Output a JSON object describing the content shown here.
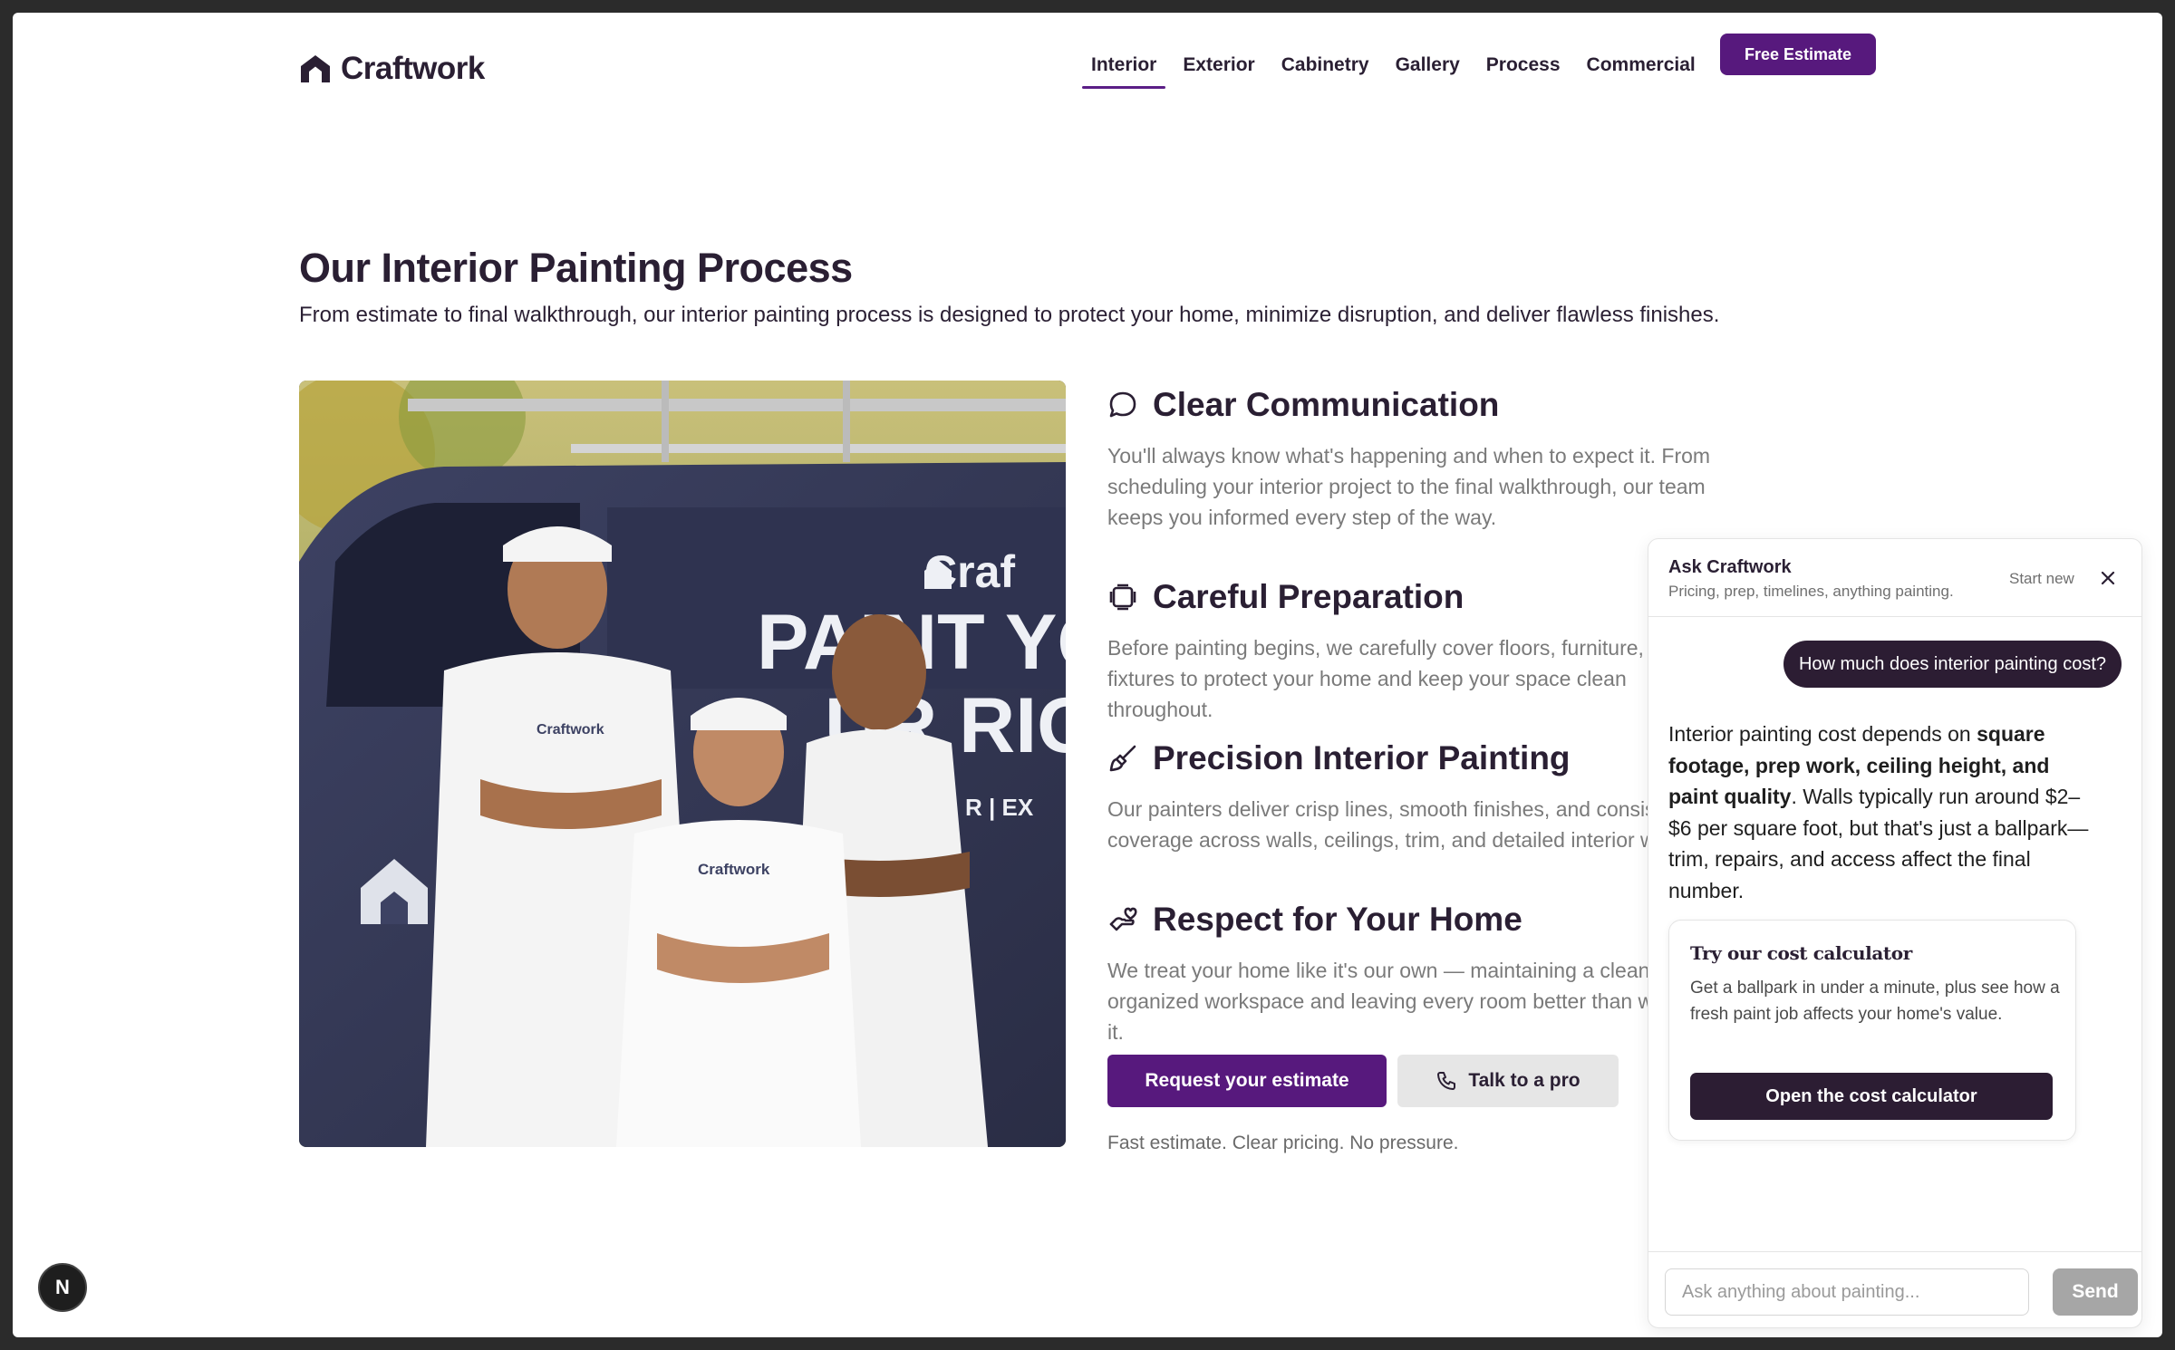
{
  "brand": {
    "name": "Craftwork",
    "accent": "#57197d",
    "dark": "#2c1d33"
  },
  "nav": {
    "items": [
      {
        "label": "Interior",
        "active": true
      },
      {
        "label": "Exterior"
      },
      {
        "label": "Cabinetry"
      },
      {
        "label": "Gallery"
      },
      {
        "label": "Process"
      },
      {
        "label": "Commercial"
      }
    ],
    "cta": "Free Estimate"
  },
  "hero": {
    "title": "Our Interior Painting Process",
    "subtitle": "From estimate to final walkthrough, our interior painting process is designed to protect your home, minimize disruption, and deliver flawless finishes."
  },
  "photo": {
    "van_text": [
      "Craf",
      "PAINT YO",
      "UR RIG",
      "R | EX"
    ],
    "shirt_text": "Craftwork"
  },
  "features": [
    {
      "icon": "chat-bubble-icon",
      "title": "Clear Communication",
      "body": "You'll always know what's happening and when to expect it. From scheduling your interior project to the final walkthrough, our team keeps you informed every step of the way."
    },
    {
      "icon": "layers-icon",
      "title": "Careful Preparation",
      "body": "Before painting begins, we carefully cover floors, furniture, and fixtures to protect your home and keep your space clean throughout."
    },
    {
      "icon": "paintbrush-icon",
      "title": "Precision Interior Painting",
      "body": "Our painters deliver crisp lines, smooth finishes, and consistent coverage across walls, ceilings, trim, and detailed interior work."
    },
    {
      "icon": "hand-heart-icon",
      "title": "Respect for Your Home",
      "body": "We treat your home like it's our own — maintaining a clean, organized workspace and leaving every room better than we found it."
    }
  ],
  "actions": {
    "request": "Request your estimate",
    "talk": "Talk to a pro",
    "tagline": "Fast estimate. Clear pricing. No pressure."
  },
  "chat": {
    "title": "Ask Craftwork",
    "subtitle": "Pricing, prep, timelines, anything painting.",
    "start_new": "Start new",
    "user_message": "How much does interior painting cost?",
    "answer_pre": "Interior painting cost depends on ",
    "answer_bold": "square footage, prep work, ceiling height, and paint quality",
    "answer_post": ". Walls typically run around $2–$6 per square foot, but that's just a ballpark—trim, repairs, and access affect the final number.",
    "calc_title": "Try our cost calculator",
    "calc_body": "Get a ballpark in under a minute, plus see how a fresh paint job affects your home's value.",
    "calc_button": "Open the cost calculator",
    "input_placeholder": "Ask anything about painting...",
    "send": "Send"
  },
  "dev_badge": "N"
}
